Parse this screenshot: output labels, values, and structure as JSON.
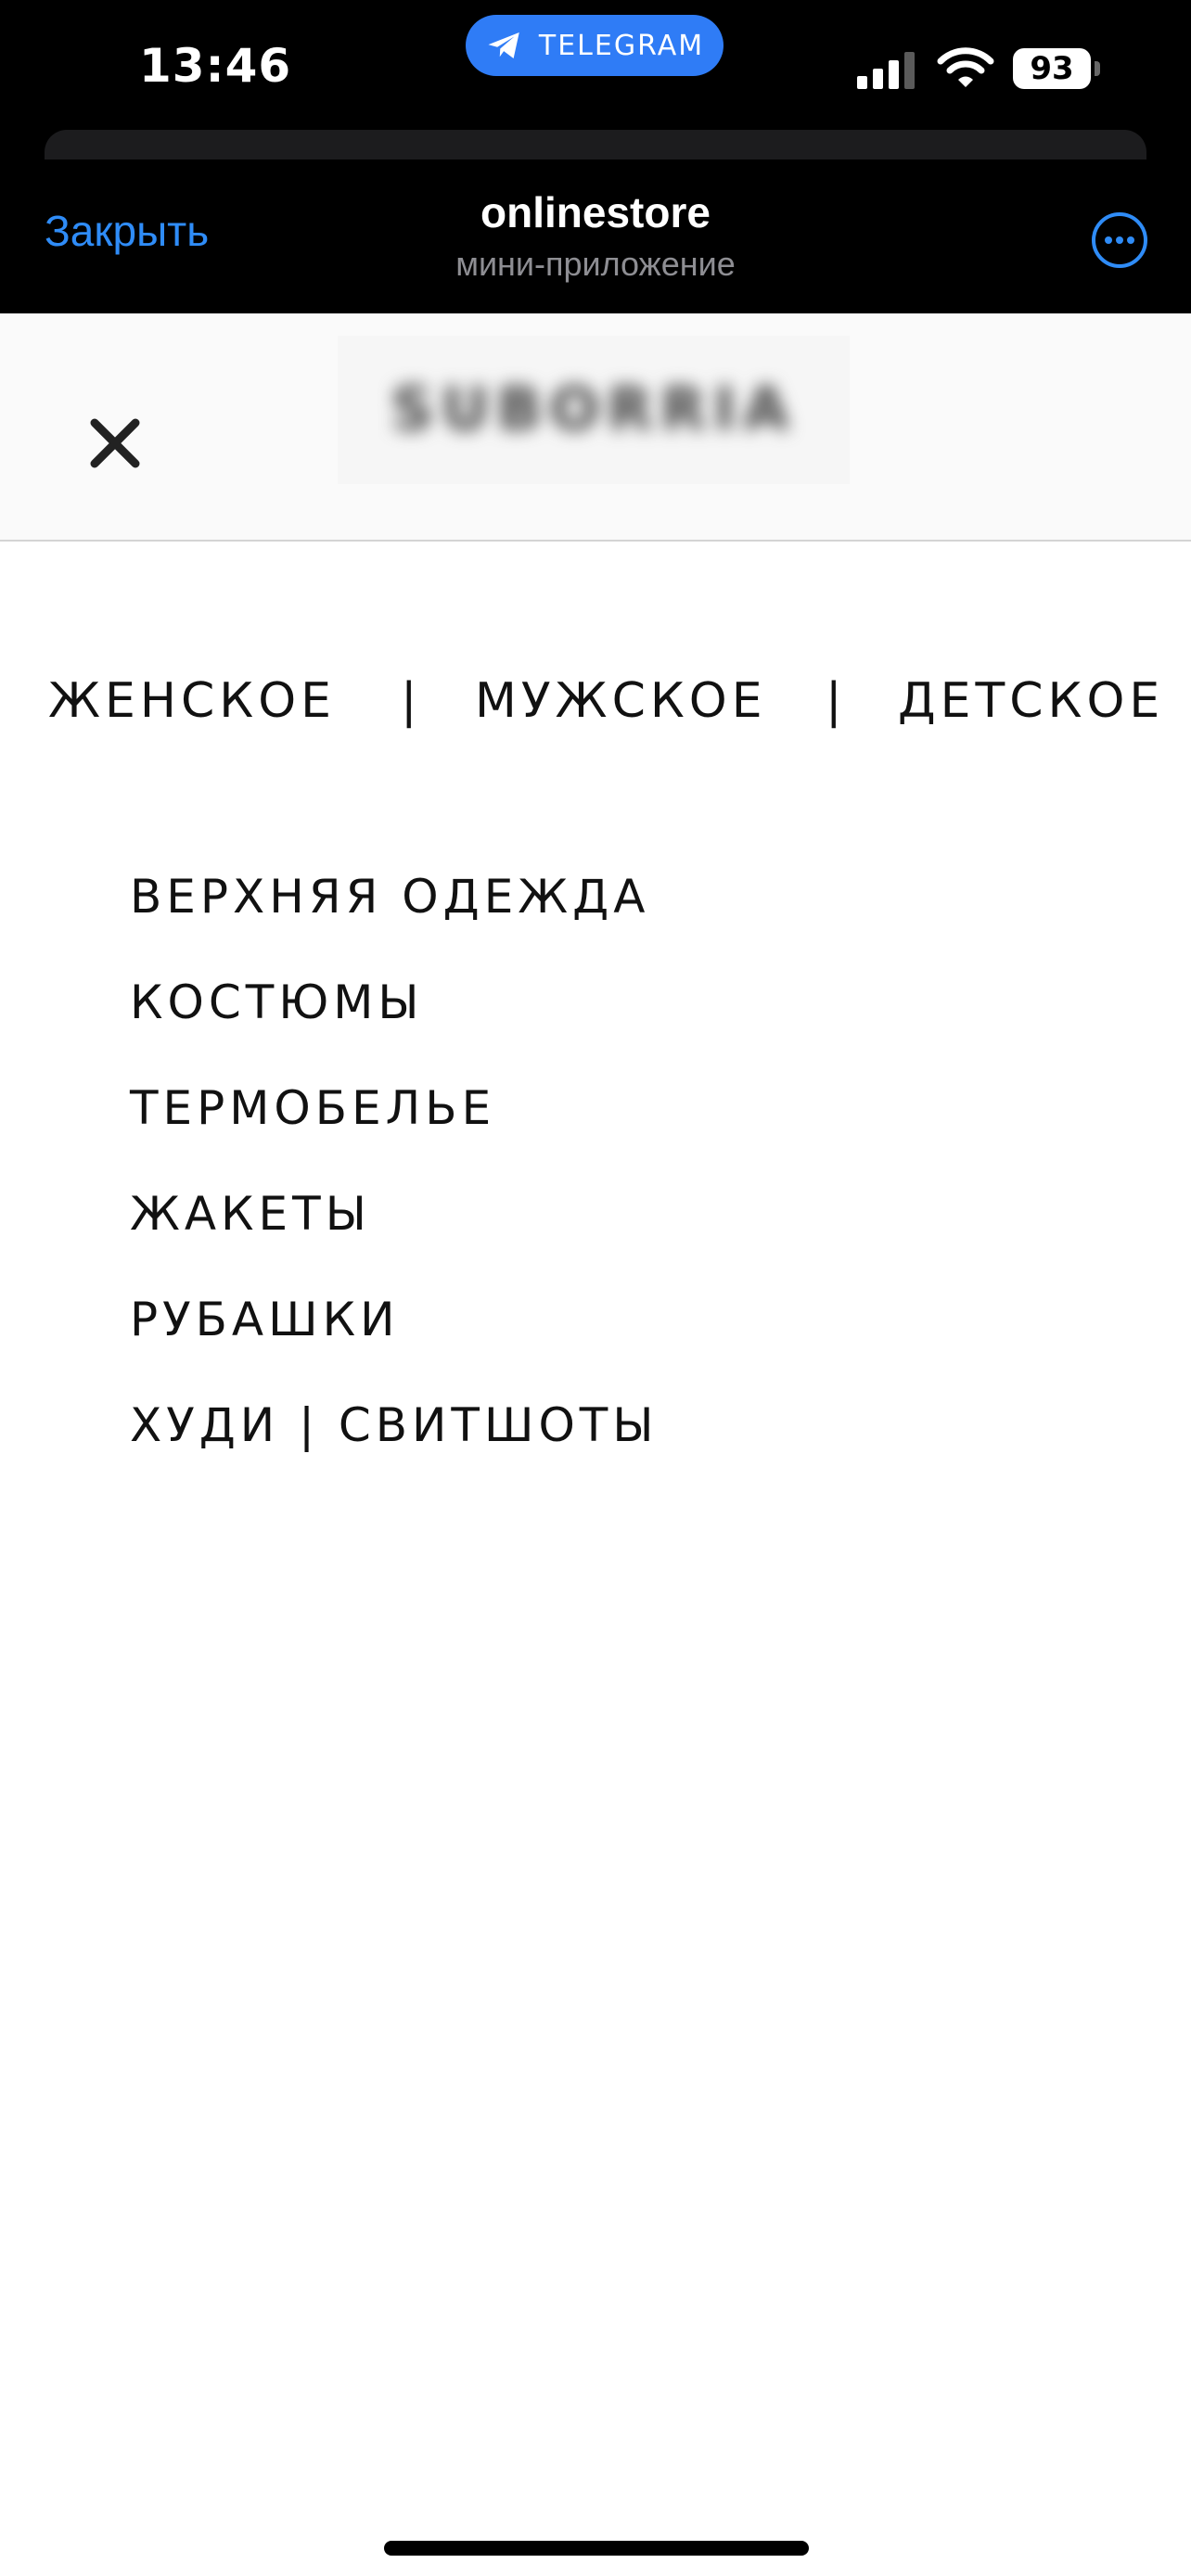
{
  "status_bar": {
    "time": "13:46",
    "pill_label": "TELEGRAM",
    "battery": "93",
    "icons": [
      "telegram-plane-icon",
      "cellular-signal-icon",
      "wifi-icon",
      "battery-icon"
    ]
  },
  "telegram_header": {
    "close_label": "Закрыть",
    "title": "onlinestore",
    "subtitle": "мини-приложение",
    "more_icon": "ellipsis-circle-icon",
    "accent_color": "#2f8cf7"
  },
  "site_header": {
    "close_icon": "close-x-icon",
    "logo_text": "SUBORRIA"
  },
  "categories": {
    "items": [
      {
        "label": "ЖЕНСКОЕ"
      },
      {
        "label": "МУЖСКОЕ"
      },
      {
        "label": "ДЕТСКОЕ"
      }
    ],
    "separator": "|"
  },
  "subcategories": {
    "items": [
      {
        "label": "ВЕРХНЯЯ ОДЕЖДА"
      },
      {
        "label": "КОСТЮМЫ"
      },
      {
        "label": "ТЕРМОБЕЛЬЕ"
      },
      {
        "label": "ЖАКЕТЫ"
      },
      {
        "label": "РУБАШКИ"
      },
      {
        "label": "ХУДИ | СВИТШОТЫ"
      }
    ]
  }
}
